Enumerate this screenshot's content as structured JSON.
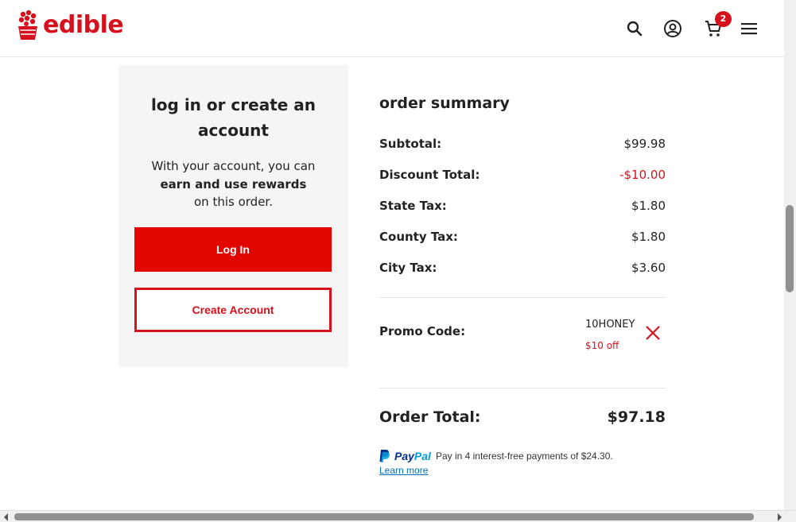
{
  "header": {
    "logo_text": "edible",
    "cart_count": "2",
    "brand_color": "#d6111d",
    "icons": [
      "search-icon",
      "account-icon",
      "cart-icon",
      "menu-icon"
    ]
  },
  "account": {
    "title": "log in or create an account",
    "desc_line1": "With your account, you can",
    "desc_bold": "earn and use rewards",
    "desc_line3": "on this order.",
    "login_label": "Log In",
    "create_label": "Create Account"
  },
  "summary": {
    "title": "order summary",
    "lines": [
      {
        "label": "Subtotal:",
        "value": "$99.98"
      },
      {
        "label": "Discount Total:",
        "value": "-$10.00"
      },
      {
        "label": "State Tax:",
        "value": "$1.80"
      },
      {
        "label": "County Tax:",
        "value": "$1.80"
      },
      {
        "label": "City Tax:",
        "value": "$3.60"
      }
    ],
    "promo_label": "Promo Code:",
    "promo_code": "10HONEY",
    "promo_off": "$10 off",
    "total_label": "Order Total:",
    "total_value": "$97.18"
  },
  "paypal": {
    "brand_pay": "Pay",
    "brand_pal": "Pal",
    "message": "Pay in 4 interest-free payments of $24.30.",
    "learn_more": "Learn more"
  }
}
